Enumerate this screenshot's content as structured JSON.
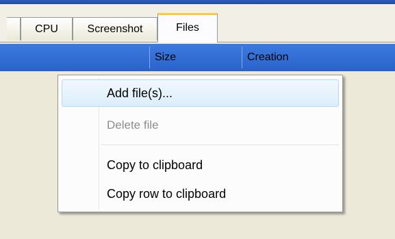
{
  "tabs": [
    {
      "label": "CPU"
    },
    {
      "label": "Screenshot"
    },
    {
      "label": "Files"
    }
  ],
  "active_tab": "Files",
  "columns": [
    {
      "label": "Size"
    },
    {
      "label": "Creation"
    }
  ],
  "context_menu": {
    "items": [
      {
        "label": "Add file(s)...",
        "state": "highlighted"
      },
      {
        "label": "Delete file",
        "state": "disabled"
      },
      {
        "label": "Copy to clipboard",
        "state": "enabled"
      },
      {
        "label": "Copy row to clipboard",
        "state": "enabled"
      }
    ]
  },
  "colors": {
    "header_blue": "#2a62c9",
    "active_tab_accent": "#ffc83c",
    "panel_background": "#ece9d8"
  }
}
